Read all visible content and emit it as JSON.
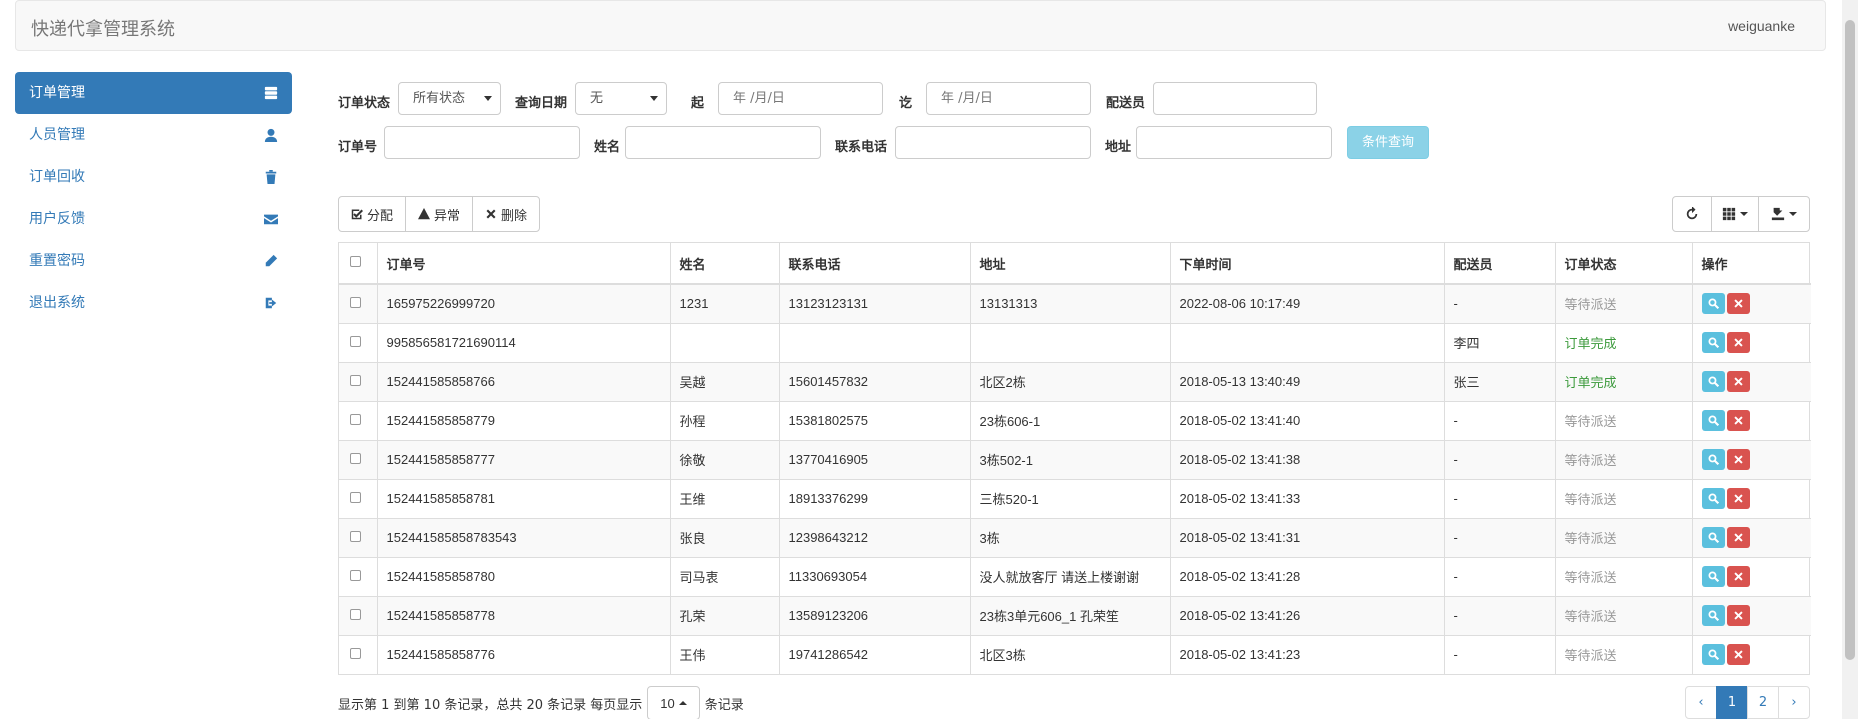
{
  "header": {
    "title": "快递代拿管理系统",
    "user": "weiguanke"
  },
  "sidebar": {
    "items": [
      {
        "label": "订单管理",
        "icon": "server-icon",
        "active": true
      },
      {
        "label": "人员管理",
        "icon": "user-icon"
      },
      {
        "label": "订单回收",
        "icon": "trash-icon"
      },
      {
        "label": "用户反馈",
        "icon": "envelope-icon"
      },
      {
        "label": "重置密码",
        "icon": "pencil-icon"
      },
      {
        "label": "退出系统",
        "icon": "logout-icon"
      }
    ]
  },
  "filters": {
    "status_label": "订单状态",
    "status_value": "所有状态",
    "date_type_label": "查询日期",
    "date_type_value": "无",
    "start_label": "起",
    "start_placeholder": "年 /月/日",
    "end_label": "讫",
    "end_placeholder": "年 /月/日",
    "courier_label": "配送员",
    "courier_value": "",
    "order_no_label": "订单号",
    "order_no_value": "",
    "name_label": "姓名",
    "name_value": "",
    "phone_label": "联系电话",
    "phone_value": "",
    "address_label": "地址",
    "address_value": "",
    "query_button": "条件查询"
  },
  "toolbar": {
    "assign": "分配",
    "abnormal": "异常",
    "delete": "删除"
  },
  "table": {
    "columns": [
      "订单号",
      "姓名",
      "联系电话",
      "地址",
      "下单时间",
      "配送员",
      "订单状态",
      "操作"
    ],
    "rows": [
      {
        "order_no": "165975226999720",
        "name": "1231",
        "phone": "13123123131",
        "address": "13131313",
        "time": "2022-08-06 10:17:49",
        "courier": "-",
        "status": "等待派送",
        "status_kind": "wait"
      },
      {
        "order_no": "995856581721690114",
        "name": "",
        "phone": "",
        "address": "",
        "time": "",
        "courier": "李四",
        "status": "订单完成",
        "status_kind": "done"
      },
      {
        "order_no": "152441585858766",
        "name": "吴越",
        "phone": "15601457832",
        "address": "北区2栋",
        "time": "2018-05-13 13:40:49",
        "courier": "张三",
        "status": "订单完成",
        "status_kind": "done"
      },
      {
        "order_no": "152441585858779",
        "name": "孙程",
        "phone": "15381802575",
        "address": "23栋606-1",
        "time": "2018-05-02 13:41:40",
        "courier": "-",
        "status": "等待派送",
        "status_kind": "wait"
      },
      {
        "order_no": "152441585858777",
        "name": "徐敬",
        "phone": "13770416905",
        "address": "3栋502-1",
        "time": "2018-05-02 13:41:38",
        "courier": "-",
        "status": "等待派送",
        "status_kind": "wait"
      },
      {
        "order_no": "152441585858781",
        "name": "王维",
        "phone": "18913376299",
        "address": "三栋520-1",
        "time": "2018-05-02 13:41:33",
        "courier": "-",
        "status": "等待派送",
        "status_kind": "wait"
      },
      {
        "order_no": "152441585858783543",
        "name": "张良",
        "phone": "12398643212",
        "address": "3栋",
        "time": "2018-05-02 13:41:31",
        "courier": "-",
        "status": "等待派送",
        "status_kind": "wait"
      },
      {
        "order_no": "152441585858780",
        "name": "司马衷",
        "phone": "11330693054",
        "address": "没人就放客厅 请送上楼谢谢",
        "time": "2018-05-02 13:41:28",
        "courier": "-",
        "status": "等待派送",
        "status_kind": "wait"
      },
      {
        "order_no": "152441585858778",
        "name": "孔荣",
        "phone": "13589123206",
        "address": "23栋3单元606_1 孔荣笙",
        "time": "2018-05-02 13:41:26",
        "courier": "-",
        "status": "等待派送",
        "status_kind": "wait"
      },
      {
        "order_no": "152441585858776",
        "name": "王伟",
        "phone": "19741286542",
        "address": "北区3栋",
        "time": "2018-05-02 13:41:23",
        "courier": "-",
        "status": "等待派送",
        "status_kind": "wait"
      }
    ]
  },
  "pagination": {
    "info_prefix": "显示第 1 到第 10 条记录，总共 20 条记录 每页显示",
    "page_size": "10",
    "info_suffix": "条记录",
    "prev": "‹",
    "pages": [
      "1",
      "2"
    ],
    "next": "›",
    "active_page": "1"
  },
  "colors": {
    "primary": "#337ab7",
    "info": "#5bc0de",
    "danger": "#d9534f",
    "success_text": "#3c9a3c"
  }
}
